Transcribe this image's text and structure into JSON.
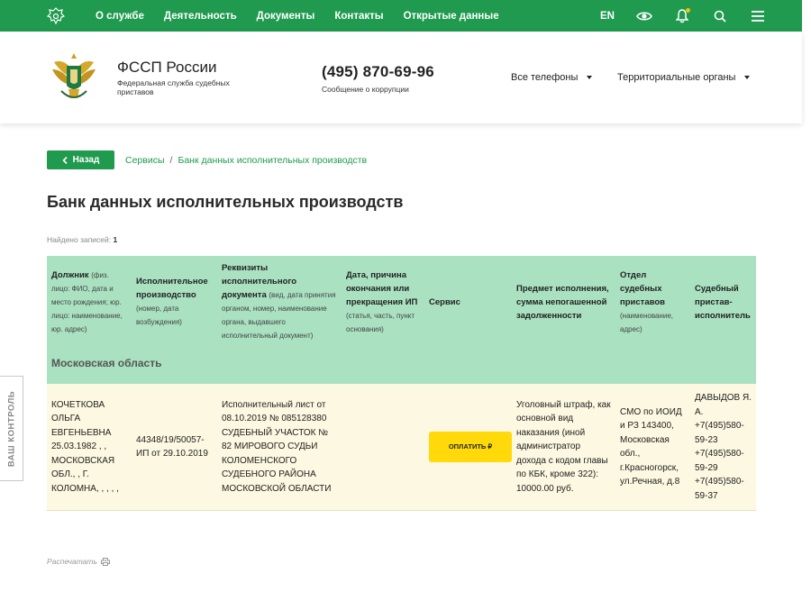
{
  "topnav": {
    "items": [
      "О службе",
      "Деятельность",
      "Документы",
      "Контакты",
      "Открытые данные"
    ],
    "lang": "EN"
  },
  "header": {
    "org_name": "ФССП России",
    "org_subtitle": "Федеральная служба судебных приставов",
    "phone": "(495) 870-69-96",
    "phone_caption": "Сообщение о коррупции",
    "dropdown_phones": "Все телефоны",
    "dropdown_regions": "Территориальные органы"
  },
  "side_tab": "ВАШ КОНТРОЛЬ",
  "breadcrumb": {
    "back_label": "Назад",
    "items": [
      "Сервисы",
      "Банк данных исполнительных производств"
    ],
    "separator": "/"
  },
  "page": {
    "title": "Банк данных исполнительных производств",
    "found_label": "Найдено записей:",
    "found_count": "1"
  },
  "table": {
    "headers": [
      {
        "title": "Должник",
        "hint": "(физ. лицо: ФИО, дата и место рождения; юр. лицо: наименование, юр. адрес)"
      },
      {
        "title": "Исполнительное производство",
        "hint": "(номер, дата возбуждения)"
      },
      {
        "title": "Реквизиты исполнительного документа",
        "hint": "(вид, дата принятия органом, номер, наименование органа, выдавшего исполнительный документ)"
      },
      {
        "title": "Дата, причина окончания или прекращения ИП",
        "hint": "(статья, часть, пункт основания)"
      },
      {
        "title": "Сервис",
        "hint": ""
      },
      {
        "title": "Предмет исполнения, сумма непогашенной задолженности",
        "hint": ""
      },
      {
        "title": "Отдел судебных приставов",
        "hint": "(наименование, адрес)"
      },
      {
        "title": "Судебный пристав-исполнитель",
        "hint": ""
      }
    ],
    "region": "Московская область",
    "row": {
      "debtor": "КОЧЕТКОВА ОЛЬГА ЕВГЕНЬЕВНА 25.03.1982 , , МОСКОВСКАЯ ОБЛ., , Г. КОЛОМНА, , , , ,",
      "proceeding": "44348/19/50057-ИП от 29.10.2019",
      "document": "Исполнительный лист от 08.10.2019 № 085128380 СУДЕБНЫЙ УЧАСТОК № 82 МИРОВОГО СУДЬИ КОЛОМЕНСКОГО СУДЕБНОГО РАЙОНА МОСКОВСКОЙ ОБЛАСТИ",
      "end_date": "",
      "pay_label": "ОПЛАТИТЬ ₽",
      "subject": "Уголовный штраф, как основной вид наказания (иной администратор дохода с кодом главы по КБК, кроме 322): 10000.00 руб.",
      "department": "СМО по ИОИД и РЗ 143400, Московская обл., г.Красногорск, ул.Речная, д.8",
      "bailiff": "ДАВЫДОВ Я. А. +7(495)580-59-23 +7(495)580-59-29 +7(495)580-59-37"
    }
  },
  "print_label": "Распечатать",
  "colors": {
    "brand_green": "#1f9a4f",
    "table_header": "#a9e1c1",
    "row_bg": "#fcf8e1",
    "pay_button": "#ffd90a"
  }
}
